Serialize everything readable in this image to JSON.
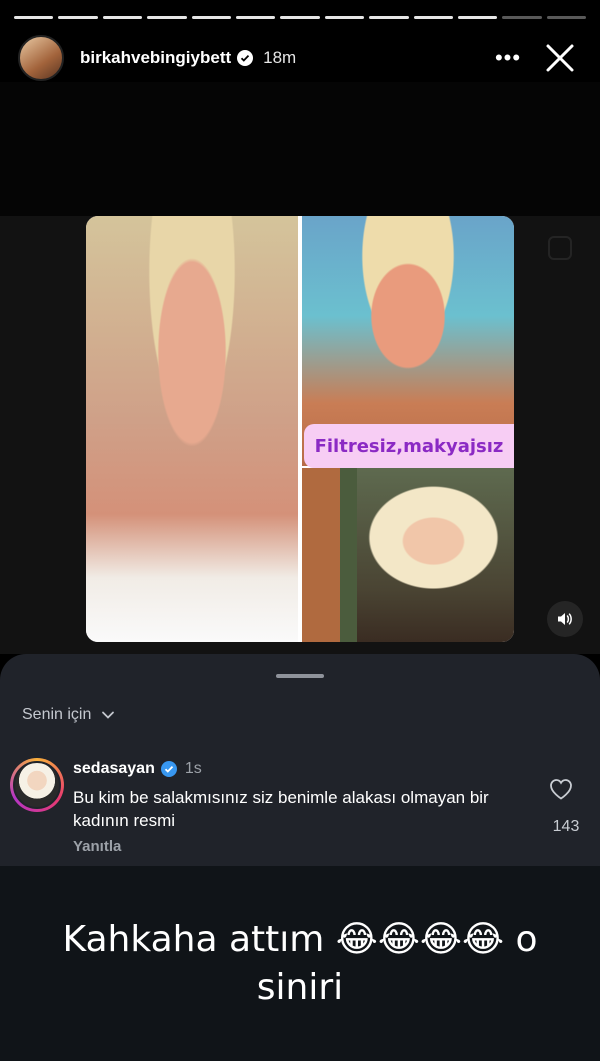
{
  "story": {
    "progress_segments": 13,
    "progress_done": 11,
    "username": "birkahvebingiybett",
    "time": "18m",
    "more_label": "•••"
  },
  "media": {
    "banner_text": "Filtresiz,makyajsız"
  },
  "comments_sheet": {
    "section_label": "Senin için",
    "comment": {
      "username": "sedasayan",
      "time": "1s",
      "text": "Bu kim be salakmısınız siz benimle alakası olmayan bir kadının resmi",
      "reply_label": "Yanıtla",
      "like_count": "143"
    }
  },
  "caption": {
    "text": "Kahkaha attım 😂😂😂😂 o siniri"
  },
  "colors": {
    "accent_verified": "#3897f0",
    "banner_bg": "#f7cdf4",
    "banner_text": "#8b2ac4",
    "sheet_bg": "#20232a"
  }
}
